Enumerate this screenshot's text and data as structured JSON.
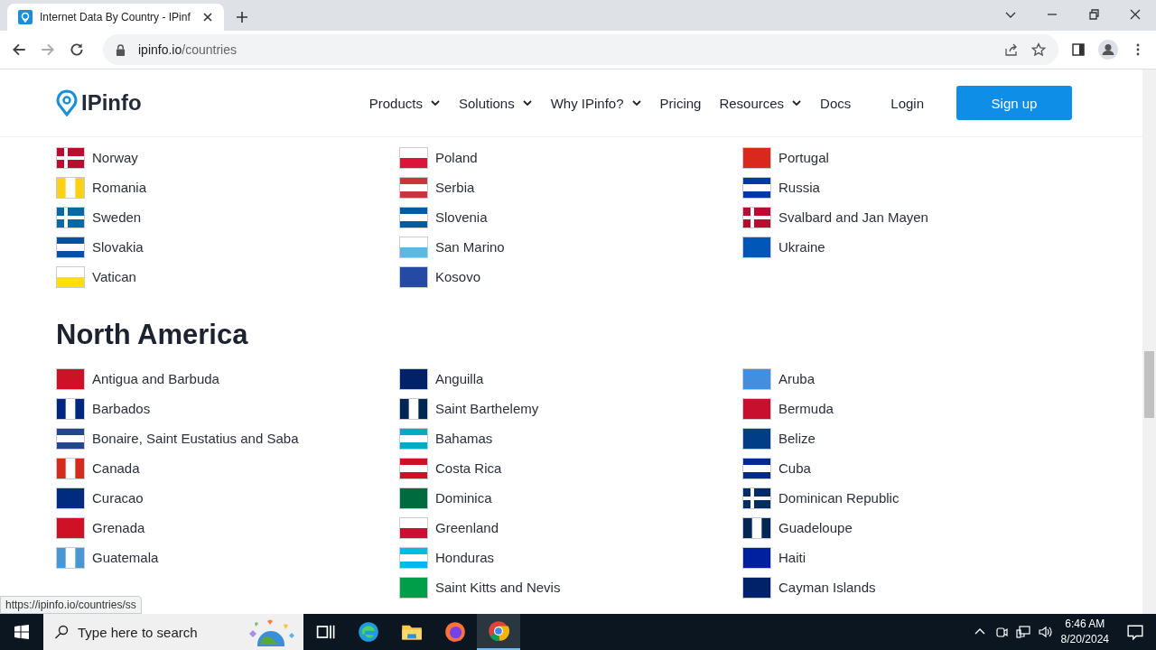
{
  "browser": {
    "tab_title": "Internet Data By Country - IPinf",
    "address_host": "ipinfo.io",
    "address_path": "/countries",
    "status_url": "https://ipinfo.io/countries/ss"
  },
  "site_header": {
    "logo": "IPinfo",
    "nav": [
      {
        "label": "Products",
        "dropdown": true
      },
      {
        "label": "Solutions",
        "dropdown": true
      },
      {
        "label": "Why IPinfo?",
        "dropdown": true
      },
      {
        "label": "Pricing",
        "dropdown": false
      },
      {
        "label": "Resources",
        "dropdown": true
      },
      {
        "label": "Docs",
        "dropdown": false
      }
    ],
    "login": "Login",
    "signup": "Sign up"
  },
  "sections": [
    {
      "columns": [
        [
          {
            "name": "Norway",
            "kind": "cross",
            "color": "#ba0c2f"
          },
          {
            "name": "Romania",
            "kind": "v",
            "color": "#fcd116"
          },
          {
            "name": "Sweden",
            "kind": "cross",
            "color": "#006aa7"
          },
          {
            "name": "Slovakia",
            "kind": "h",
            "color": "#0b4ea2"
          },
          {
            "name": "Vatican",
            "kind": "half",
            "color": "#ffe000"
          }
        ],
        [
          {
            "name": "Poland",
            "kind": "half",
            "color": "#dc143c"
          },
          {
            "name": "Serbia",
            "kind": "h",
            "color": "#c6363c"
          },
          {
            "name": "Slovenia",
            "kind": "h",
            "color": "#005da4"
          },
          {
            "name": "San Marino",
            "kind": "half",
            "color": "#5eb6e4"
          },
          {
            "name": "Kosovo",
            "kind": "plain",
            "color": "#244aa5"
          }
        ],
        [
          {
            "name": "Portugal",
            "kind": "plain",
            "color": "#da291c"
          },
          {
            "name": "Russia",
            "kind": "h",
            "color": "#0039a6"
          },
          {
            "name": "Svalbard and Jan Mayen",
            "kind": "cross",
            "color": "#ba0c2f"
          },
          {
            "name": "Ukraine",
            "kind": "plain",
            "color": "#0057b7"
          }
        ]
      ]
    },
    {
      "title": "North America",
      "columns": [
        [
          {
            "name": "Antigua and Barbuda",
            "kind": "plain",
            "color": "#ce1126"
          },
          {
            "name": "Barbados",
            "kind": "v",
            "color": "#00267f"
          },
          {
            "name": "Bonaire, Saint Eustatius and Saba",
            "kind": "h",
            "color": "#21468b"
          },
          {
            "name": "Canada",
            "kind": "v",
            "color": "#d52b1e"
          },
          {
            "name": "Curacao",
            "kind": "plain",
            "color": "#002b7f"
          },
          {
            "name": "Grenada",
            "kind": "plain",
            "color": "#ce1126"
          },
          {
            "name": "Guatemala",
            "kind": "v",
            "color": "#4997d0"
          }
        ],
        [
          {
            "name": "Anguilla",
            "kind": "plain",
            "color": "#012169"
          },
          {
            "name": "Saint Barthelemy",
            "kind": "v",
            "color": "#002654"
          },
          {
            "name": "Bahamas",
            "kind": "h",
            "color": "#00abc9"
          },
          {
            "name": "Costa Rica",
            "kind": "h",
            "color": "#ce1126"
          },
          {
            "name": "Dominica",
            "kind": "plain",
            "color": "#006b3f"
          },
          {
            "name": "Greenland",
            "kind": "half",
            "color": "#d00c33"
          },
          {
            "name": "Honduras",
            "kind": "h",
            "color": "#00bce4"
          },
          {
            "name": "Saint Kitts and Nevis",
            "kind": "plain",
            "color": "#009e49"
          }
        ],
        [
          {
            "name": "Aruba",
            "kind": "plain",
            "color": "#418fde"
          },
          {
            "name": "Bermuda",
            "kind": "plain",
            "color": "#c8102e"
          },
          {
            "name": "Belize",
            "kind": "plain",
            "color": "#003f87"
          },
          {
            "name": "Cuba",
            "kind": "h",
            "color": "#002a8f"
          },
          {
            "name": "Dominican Republic",
            "kind": "cross",
            "color": "#002d62"
          },
          {
            "name": "Guadeloupe",
            "kind": "v",
            "color": "#002654"
          },
          {
            "name": "Haiti",
            "kind": "plain",
            "color": "#00209f"
          },
          {
            "name": "Cayman Islands",
            "kind": "plain",
            "color": "#012169"
          }
        ]
      ]
    }
  ],
  "taskbar": {
    "search_placeholder": "Type here to search",
    "time": "6:46 AM",
    "date": "8/20/2024"
  }
}
